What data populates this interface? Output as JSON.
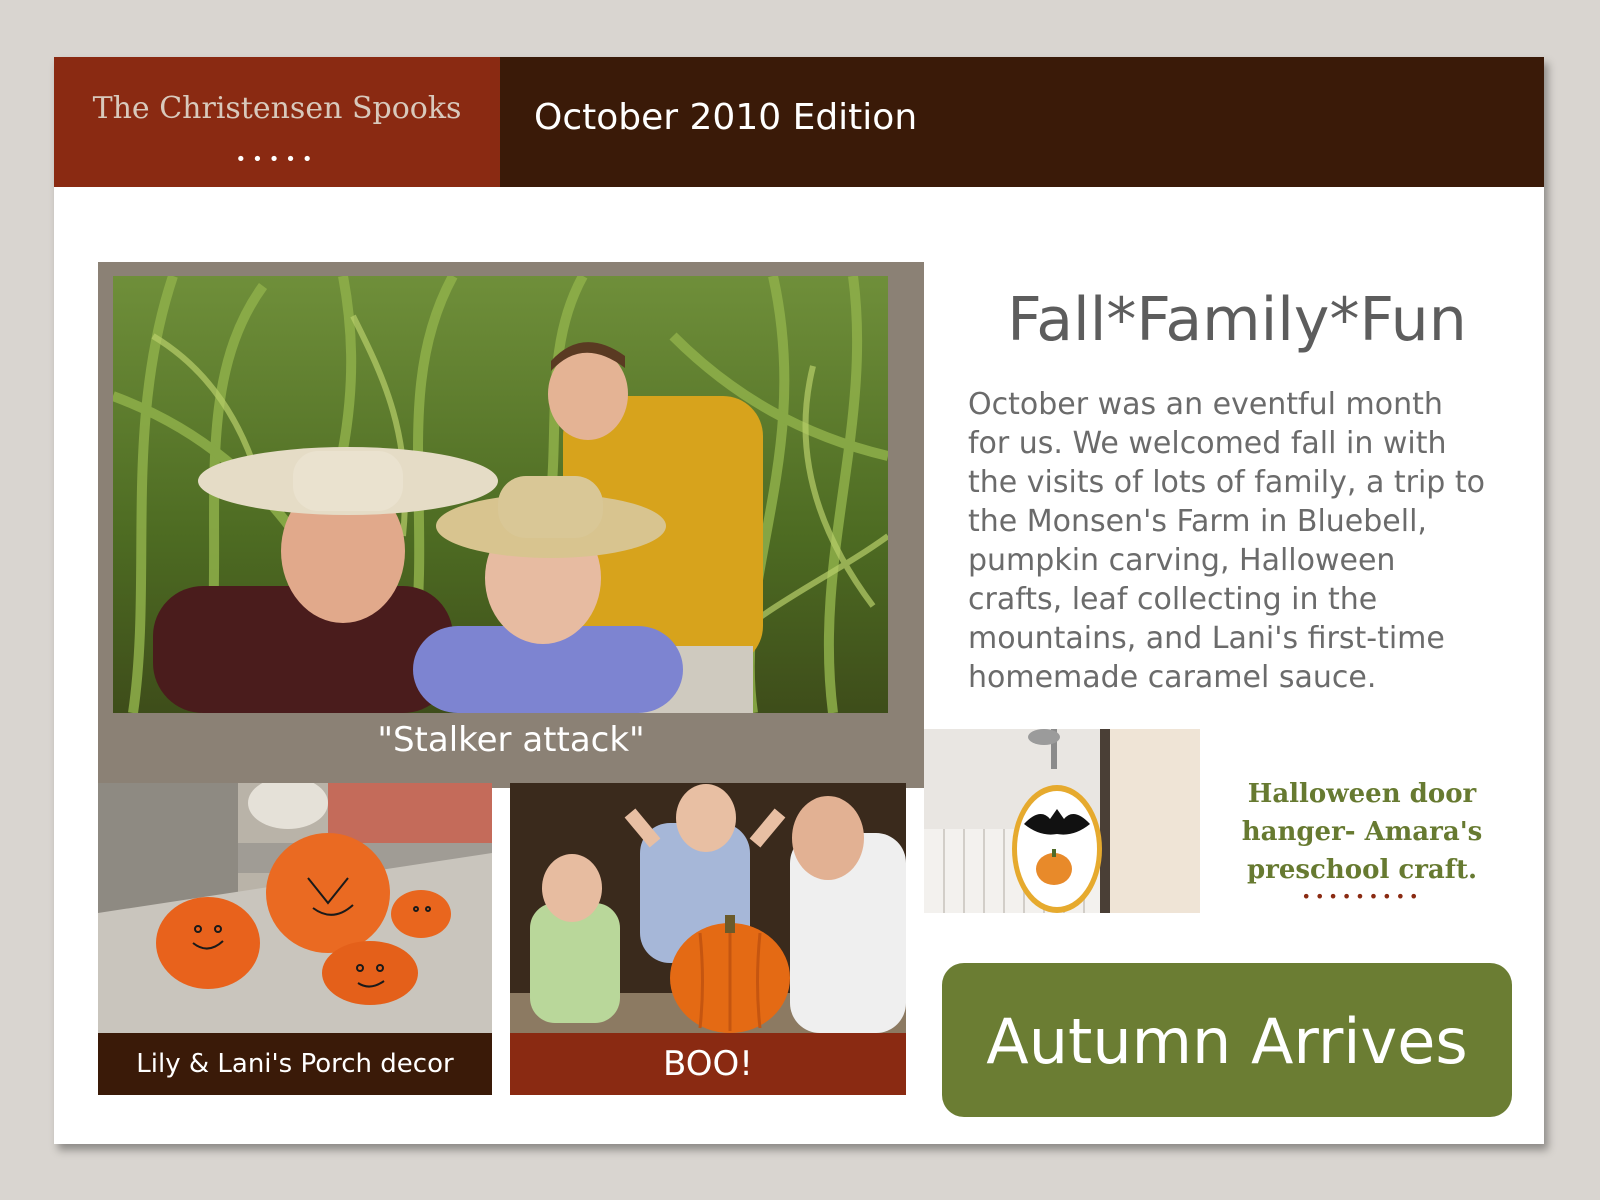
{
  "masthead": {
    "family_name": "The Christensen Spooks",
    "dots": "•••••",
    "edition": "October 2010 Edition"
  },
  "main_photo": {
    "caption": "\"Stalker attack\""
  },
  "article": {
    "headline": "Fall*Family*Fun",
    "lines": [
      "October was an eventful month",
      "for us.  We welcomed fall in with",
      "the visits of lots of family, a trip to",
      "the Monsen's Farm in Bluebell,",
      "pumpkin carving, Halloween",
      "crafts, leaf collecting in the",
      "mountains, and Lani's first-time",
      "homemade caramel sauce."
    ]
  },
  "craft": {
    "lines": [
      "Halloween door",
      "hanger- Amara's",
      "preschool craft."
    ],
    "dots": "•••••••••"
  },
  "porch_photo": {
    "caption": "Lily & Lani's Porch decor"
  },
  "boo_photo": {
    "caption": "BOO!"
  },
  "banner": {
    "title": "Autumn Arrives"
  },
  "colors": {
    "rust": "#8a2a12",
    "dark_brown": "#3a1a08",
    "taupe": "#8b8175",
    "olive": "#6b7d33"
  }
}
